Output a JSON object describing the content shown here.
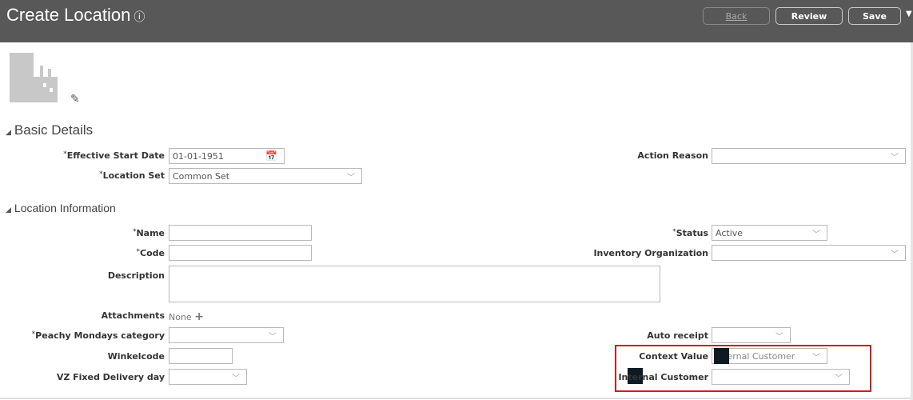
{
  "header": {
    "title": "Create Location",
    "back": "Back",
    "review": "Review",
    "save": "Save"
  },
  "sections": {
    "basic": "Basic Details",
    "location": "Location Information"
  },
  "fields": {
    "effective_start_date": {
      "label": "Effective Start Date",
      "value": "01-01-1951"
    },
    "location_set": {
      "label": "Location Set",
      "value": "Common Set"
    },
    "action_reason": {
      "label": "Action Reason",
      "value": ""
    },
    "name": {
      "label": "Name",
      "value": ""
    },
    "code": {
      "label": "Code",
      "value": ""
    },
    "description": {
      "label": "Description",
      "value": ""
    },
    "attachments": {
      "label": "Attachments",
      "value": "None"
    },
    "peachy": {
      "label": "Peachy Mondays category",
      "value": ""
    },
    "winkelcode": {
      "label": "Winkelcode",
      "value": ""
    },
    "vz": {
      "label": "VZ Fixed Delivery day",
      "value": ""
    },
    "status": {
      "label": "Status",
      "value": "Active"
    },
    "inventory_org": {
      "label": "Inventory Organization",
      "value": ""
    },
    "auto_receipt": {
      "label": "Auto receipt",
      "value": ""
    },
    "context_value": {
      "label": "Context Value",
      "value": "Internal Customer"
    },
    "internal_customer": {
      "label": "Internal Customer",
      "value": ""
    }
  },
  "req": "*",
  "colors": {
    "header": "#585858",
    "highlight": "#cc1f1f"
  }
}
